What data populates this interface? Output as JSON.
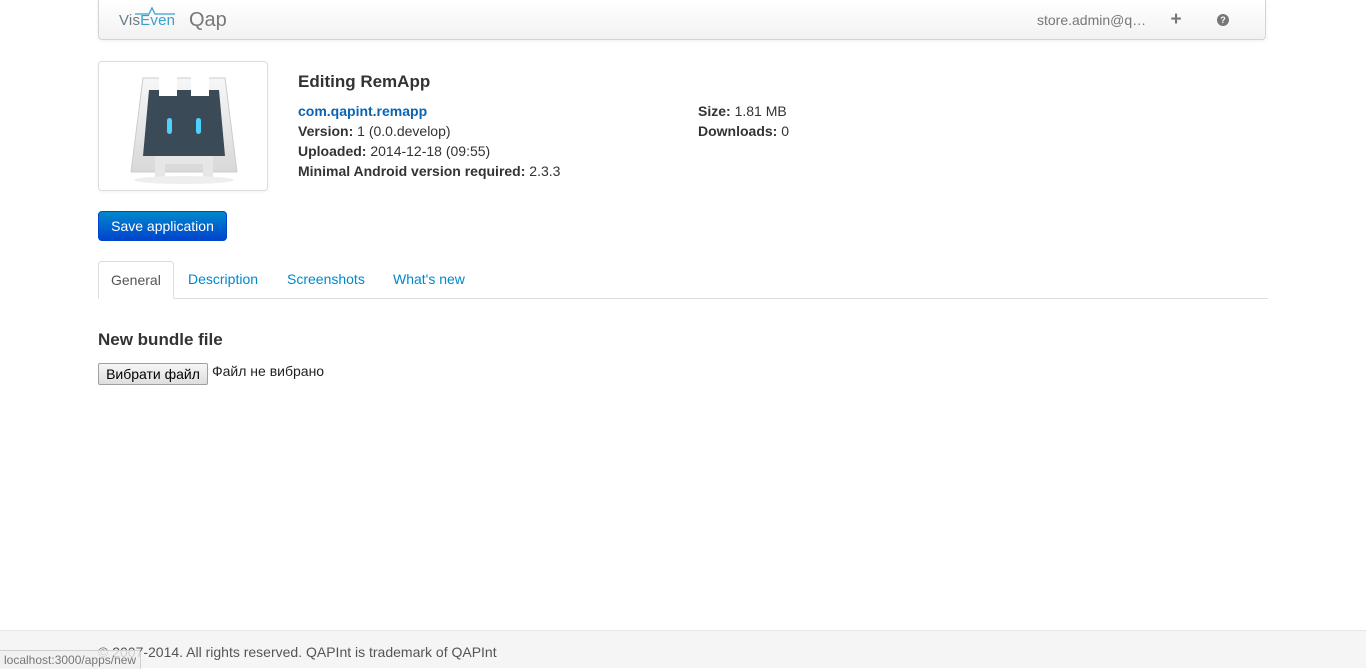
{
  "navbar": {
    "logo_text_left": "Vis",
    "logo_text_accent": "Even",
    "app_name": "Qap",
    "user": "store.admin@q…",
    "add_icon": "plus-icon",
    "help_icon": "question-circle-icon",
    "add_glyph": "+",
    "help_glyph": "?"
  },
  "app": {
    "title": "Editing RemApp",
    "package": "com.qapint.remapp",
    "version_label": "Version:",
    "version_value": "1 (0.0.develop)",
    "uploaded_label": "Uploaded:",
    "uploaded_value": "2014-12-18 (09:55)",
    "min_android_label": "Minimal Android version required:",
    "min_android_value": "2.3.3",
    "size_label": "Size:",
    "size_value": "1.81 MB",
    "downloads_label": "Downloads:",
    "downloads_value": "0"
  },
  "actions": {
    "save_label": "Save application"
  },
  "tabs": [
    {
      "label": "General",
      "active": true
    },
    {
      "label": "Description",
      "active": false
    },
    {
      "label": "Screenshots",
      "active": false
    },
    {
      "label": "What's new",
      "active": false
    }
  ],
  "bundle": {
    "title": "New bundle file",
    "choose_button": "Вибрати файл",
    "status": "Файл не вибрано"
  },
  "footer": {
    "copyright": "© 2007-2014. All rights reserved. QAPInt is trademark of QAPInt"
  },
  "statusbar": {
    "url": "localhost:3000/apps/new"
  },
  "colors": {
    "primary": "#0044cc",
    "link": "#0088cc",
    "package_link": "#0a64b4"
  }
}
